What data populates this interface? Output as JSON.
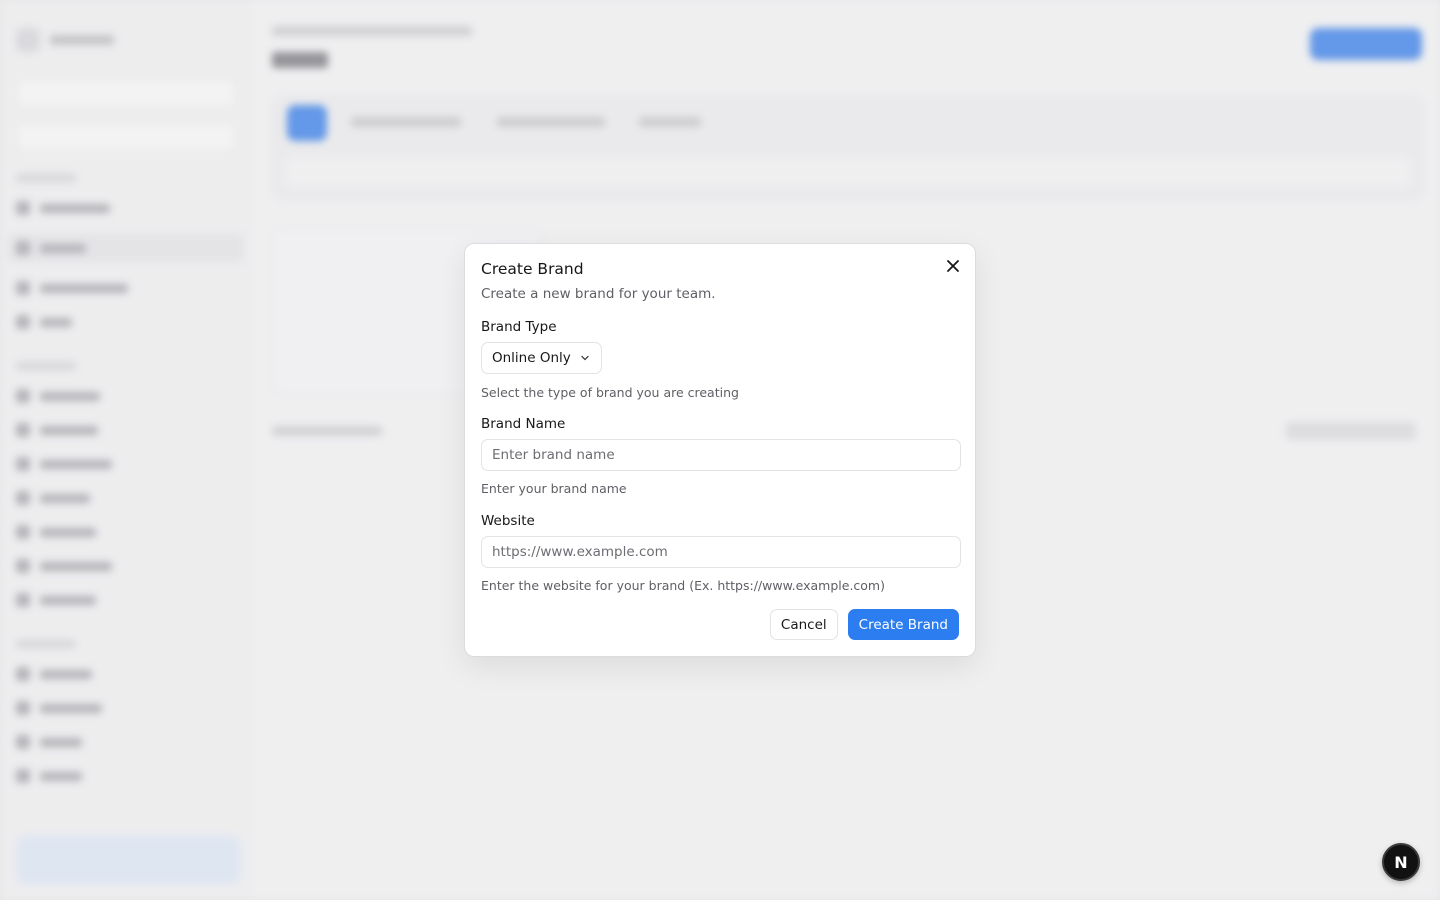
{
  "dialog": {
    "title": "Create Brand",
    "description": "Create a new brand for your team.",
    "close_icon": "close-icon",
    "brand_type": {
      "label": "Brand Type",
      "selected": "Online Only",
      "help": "Select the type of brand you are creating"
    },
    "brand_name": {
      "label": "Brand Name",
      "value": "",
      "placeholder": "Enter brand name",
      "help": "Enter your brand name"
    },
    "website": {
      "label": "Website",
      "value": "",
      "placeholder": "https://www.example.com",
      "help": "Enter the website for your brand (Ex. https://www.example.com)"
    },
    "cancel_label": "Cancel",
    "submit_label": "Create Brand"
  },
  "dev_badge": {
    "letter": "N"
  },
  "colors": {
    "primary": "#2b7df0",
    "text": "#171717",
    "muted": "#5f5f66",
    "border": "#e3e3e5"
  }
}
